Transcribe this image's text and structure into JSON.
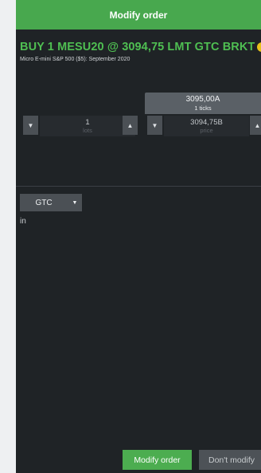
{
  "dialog": {
    "title": "Modify order",
    "order_summary": "BUY 1 MESU20 @ 3094,75 LMT GTC BRKT",
    "info_icon": "info-icon",
    "instrument": "Micro E-mini S&P 500 ($5): September 2020"
  },
  "limit_reference": {
    "price": "3095,00A",
    "ticks": "1 ticks"
  },
  "quantity": {
    "value": "1",
    "label": "lots",
    "decrement_icon": "chevron-down-icon",
    "increment_icon": "chevron-up-icon"
  },
  "price": {
    "value": "3094,75B",
    "label": "price",
    "decrement_icon": "chevron-down-icon",
    "increment_icon": "chevron-up-icon"
  },
  "time_in_force": {
    "selected": "GTC",
    "dropdown_icon": "chevron-down-icon"
  },
  "in_label": "in",
  "actions": {
    "modify_label": "Modify order",
    "dont_modify_label": "Don't modify"
  },
  "colors": {
    "accent_green": "#4cad50",
    "panel_bg": "#1f2326",
    "warning_yellow": "#e8c21a"
  }
}
